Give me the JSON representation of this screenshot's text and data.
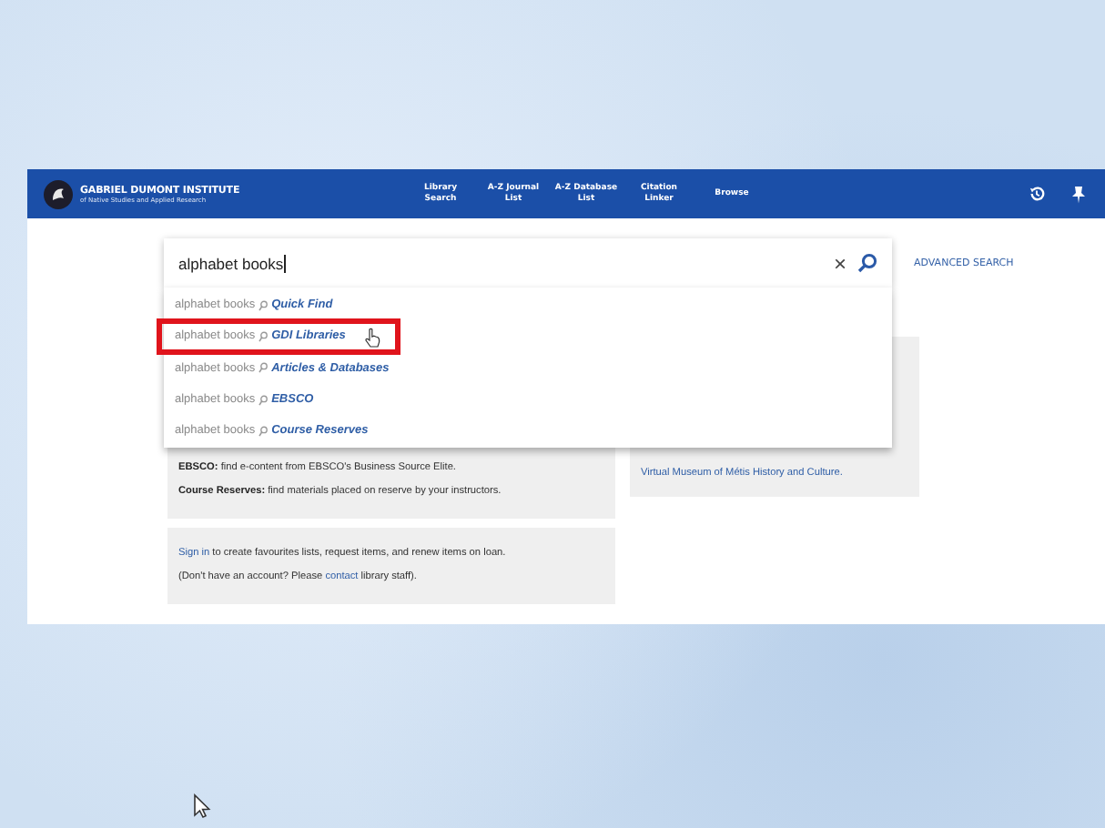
{
  "header": {
    "title": "GABRIEL DUMONT INSTITUTE",
    "subtitle": "of Native Studies and Applied Research",
    "nav": [
      "Library Search",
      "A-Z Journal List",
      "A-Z Database List",
      "Citation Linker",
      "Browse"
    ]
  },
  "search": {
    "value": "alphabet books",
    "clear": "×",
    "advanced": "ADVANCED SEARCH"
  },
  "suggestions": [
    {
      "query": "alphabet books",
      "scope": "Quick Find",
      "selected": false
    },
    {
      "query": "alphabet books",
      "scope": "GDI Libraries",
      "selected": true
    },
    {
      "query": "alphabet books",
      "scope": "Articles & Databases",
      "selected": false
    },
    {
      "query": "alphabet books",
      "scope": "EBSCO",
      "selected": false
    },
    {
      "query": "alphabet books",
      "scope": "Course Reserves",
      "selected": false
    }
  ],
  "info_card": {
    "lines": [
      "**EBSCO:** find e-content from EBSCO's Business Source Elite.",
      "**Course Reserves:** find materials placed on reserve by your instructors."
    ]
  },
  "side_card": {
    "link": "Virtual Museum of Métis History and Culture."
  },
  "account_card": {
    "lines": [
      {
        "link": "Sign in",
        "after": " to create favourites lists, request items, and renew items on loan."
      },
      {
        "before": "(Don't have an account? Please ",
        "link": "contact",
        "after": " library staff)."
      }
    ]
  }
}
